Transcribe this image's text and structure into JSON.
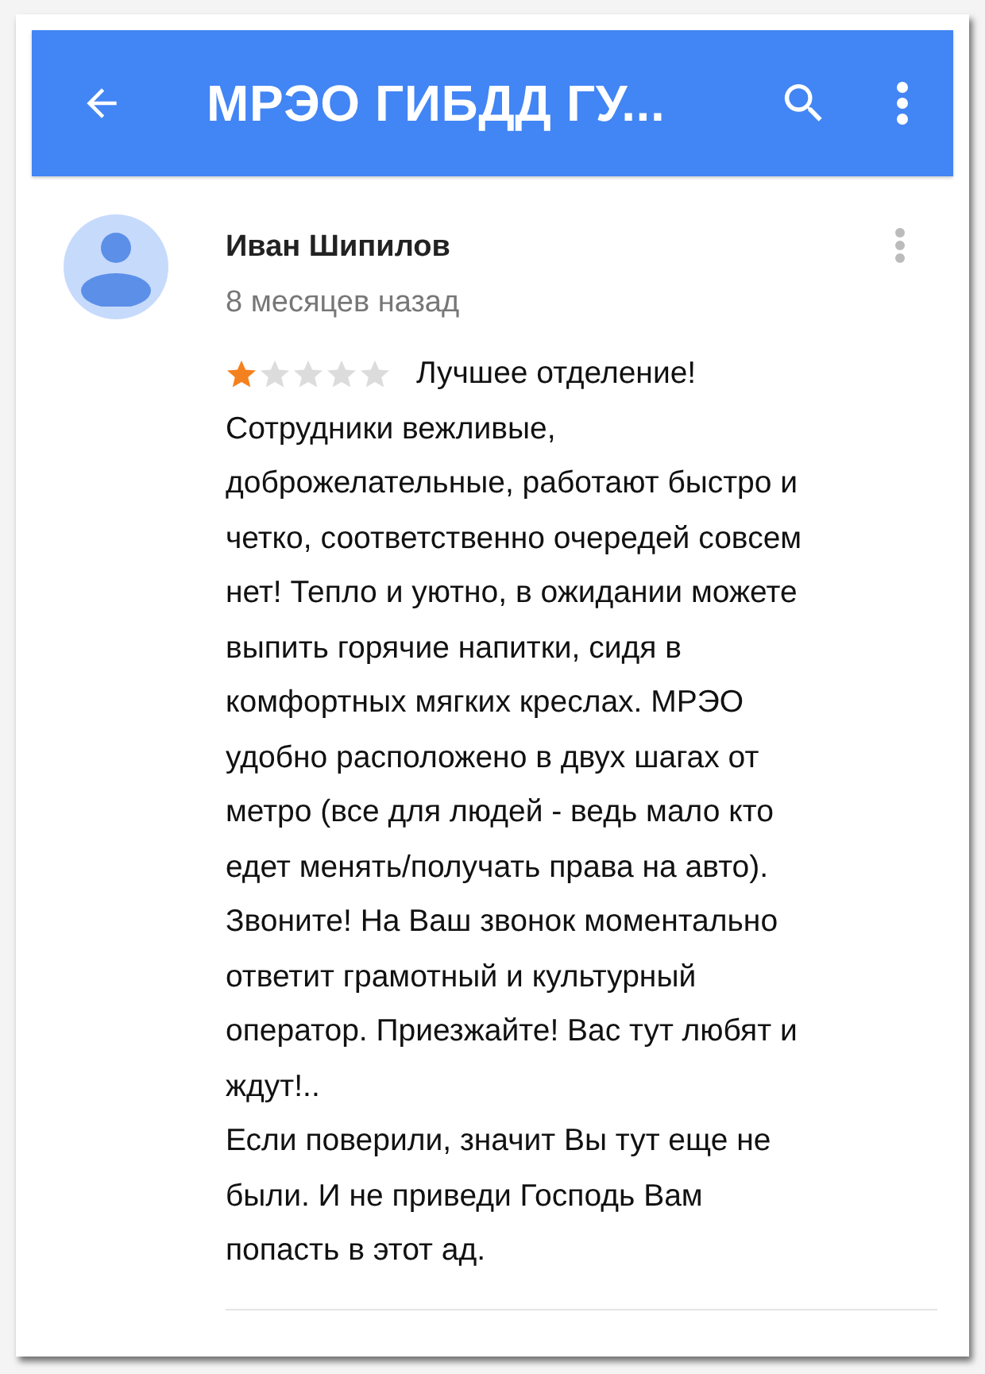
{
  "app_bar": {
    "title": "МРЭО ГИБДД ГУ..."
  },
  "review": {
    "author": "Иван Шипилов",
    "time": "8 месяцев назад",
    "stars": 1,
    "headline": "Лучшее отделение!",
    "paragraphs": [
      "Сотрудники вежливые,\nдоброжелательные, работают быстро и\nчетко, соответственно очередей совсем\nнет! Тепло и уютно, в ожидании можете\nвыпить горячие напитки, сидя в\nкомфортных мягких креслах. МРЭО\nудобно расположено в двух шагах от\nметро (все для людей - ведь мало кто\nедет менять/получать права на авто).\nЗвоните! На Ваш звонок моментально\nответит грамотный и культурный\nоператор. Приезжайте! Вас тут любят и\nждут!..",
      "Если поверили, значит Вы тут еще не\nбыли. И не приведи Господь Вам\nпопасть в этот ад."
    ]
  }
}
